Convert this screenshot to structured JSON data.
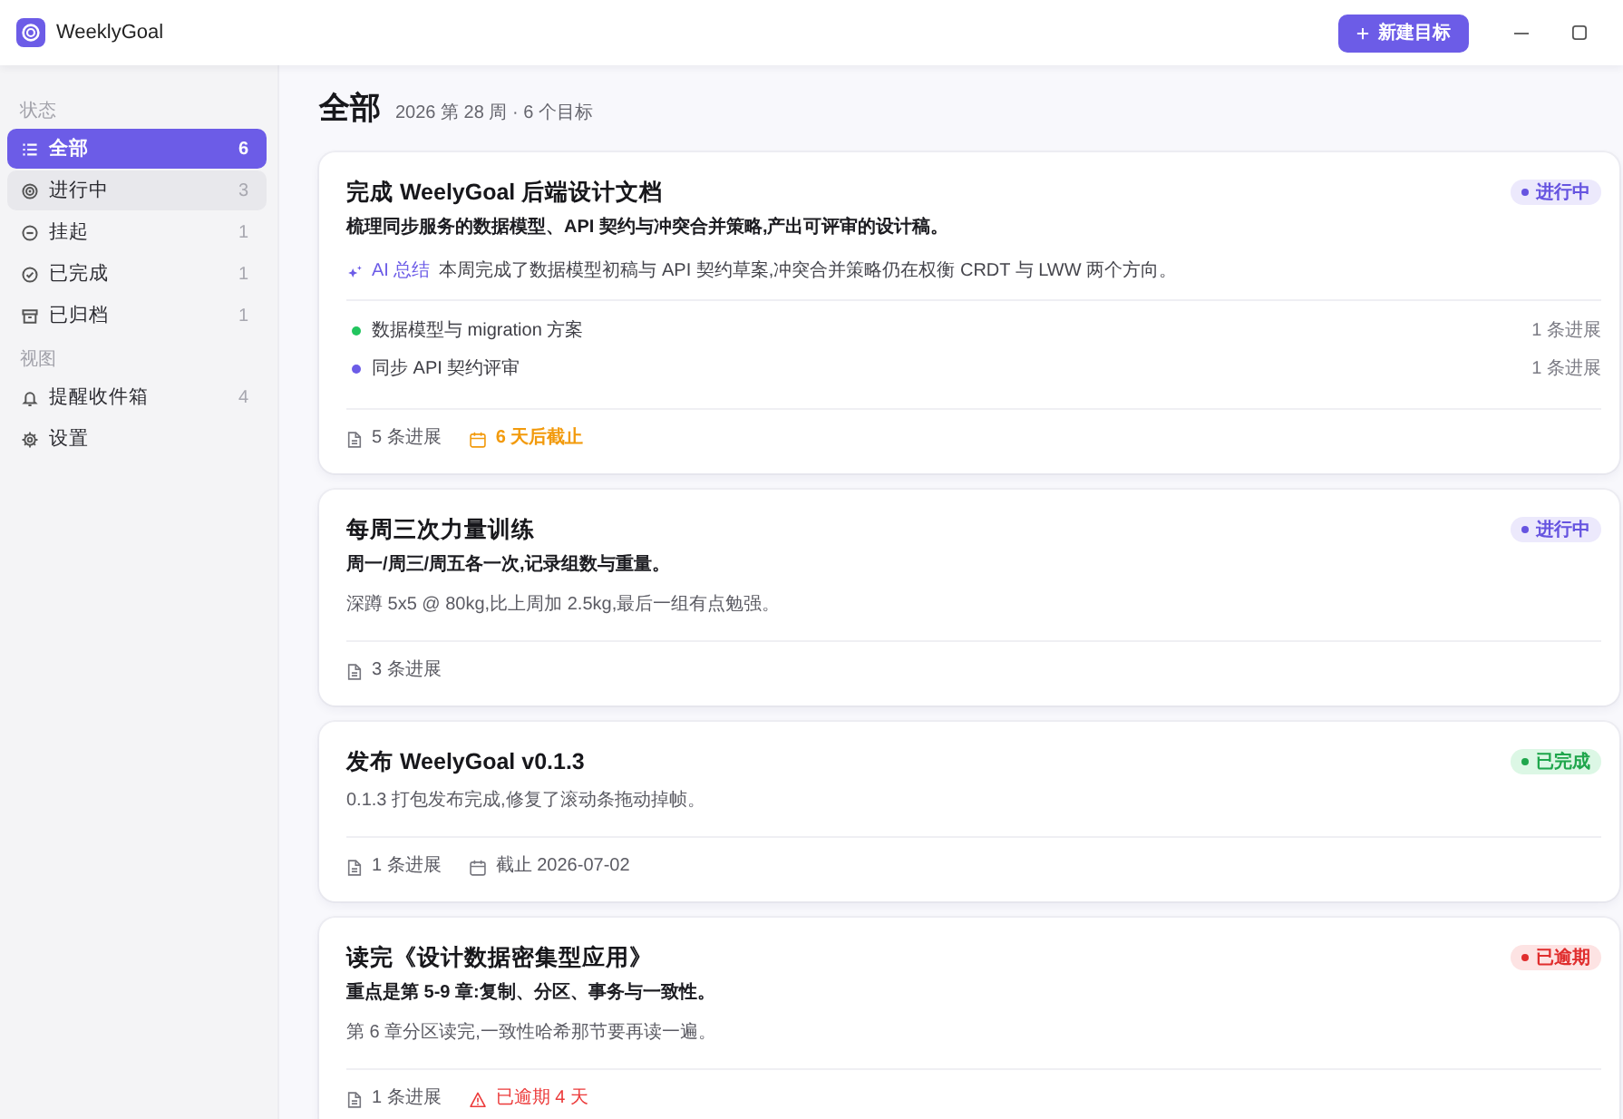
{
  "window": {
    "app_name": "WeeklyGoal"
  },
  "toolbar": {
    "new_goal_button": "新建目标"
  },
  "sidebar": {
    "sections": [
      {
        "label": "状态",
        "items": [
          {
            "kind": "all",
            "label": "全部",
            "count": "6",
            "selected": true,
            "hovered": false
          },
          {
            "kind": "in_progress",
            "label": "进行中",
            "count": "3",
            "selected": false,
            "hovered": true
          },
          {
            "kind": "paused",
            "label": "挂起",
            "count": "1",
            "selected": false,
            "hovered": false
          },
          {
            "kind": "completed",
            "label": "已完成",
            "count": "1",
            "selected": false,
            "hovered": false
          },
          {
            "kind": "archived",
            "label": "已归档",
            "count": "1",
            "selected": false,
            "hovered": false
          }
        ]
      },
      {
        "label": "视图",
        "items": [
          {
            "kind": "inbox",
            "label": "提醒收件箱",
            "count": "4",
            "selected": false,
            "hovered": false
          },
          {
            "kind": "settings",
            "label": "设置",
            "selected": false,
            "hovered": false
          }
        ]
      }
    ]
  },
  "main": {
    "title": "全部",
    "subtitle": "2026 第 28 周 · 6 个目标",
    "goals": [
      {
        "title": "完成 WeelyGoal 后端设计文档",
        "status": {
          "kind": "active",
          "label": "进行中"
        },
        "description": "梳理同步服务的数据模型、API 契约与冲突合并策略,产出可评审的设计稿。",
        "ai_summary": {
          "label": "AI 总结",
          "text": "本周完成了数据模型初稿与 API 契约草案,冲突合并策略仍在权衡 CRDT 与 LWW 两个方向。"
        },
        "subgoals": [
          {
            "title": "数据模型与 migration 方案",
            "updates": "1 条进展",
            "color": "#22c55e"
          },
          {
            "title": "同步 API 契约评审",
            "updates": "1 条进展",
            "color": "#6c5ce7"
          }
        ],
        "meta": [
          {
            "kind": "updates",
            "text": "5 条进展"
          },
          {
            "kind": "due_soon",
            "text": "6 天后截止"
          }
        ]
      },
      {
        "title": "每周三次力量训练",
        "status": {
          "kind": "active",
          "label": "进行中"
        },
        "description": "周一/周三/周五各一次,记录组数与重量。",
        "note": "深蹲 5x5 @ 80kg,比上周加 2.5kg,最后一组有点勉强。",
        "meta": [
          {
            "kind": "updates",
            "text": "3 条进展"
          }
        ]
      },
      {
        "title": "发布 WeelyGoal v0.1.3",
        "status": {
          "kind": "done",
          "label": "已完成"
        },
        "note": "0.1.3 打包发布完成,修复了滚动条拖动掉帧。",
        "meta": [
          {
            "kind": "updates",
            "text": "1 条进展"
          },
          {
            "kind": "due",
            "text": "截止 2026-07-02"
          }
        ]
      },
      {
        "title": "读完《设计数据密集型应用》",
        "status": {
          "kind": "overdue",
          "label": "已逾期"
        },
        "description": "重点是第 5-9 章:复制、分区、事务与一致性。",
        "note": "第 6 章分区读完,一致性哈希那节要再读一遍。",
        "meta": [
          {
            "kind": "updates",
            "text": "1 条进展"
          },
          {
            "kind": "overdue",
            "text": "已逾期 4 天"
          }
        ]
      }
    ]
  }
}
